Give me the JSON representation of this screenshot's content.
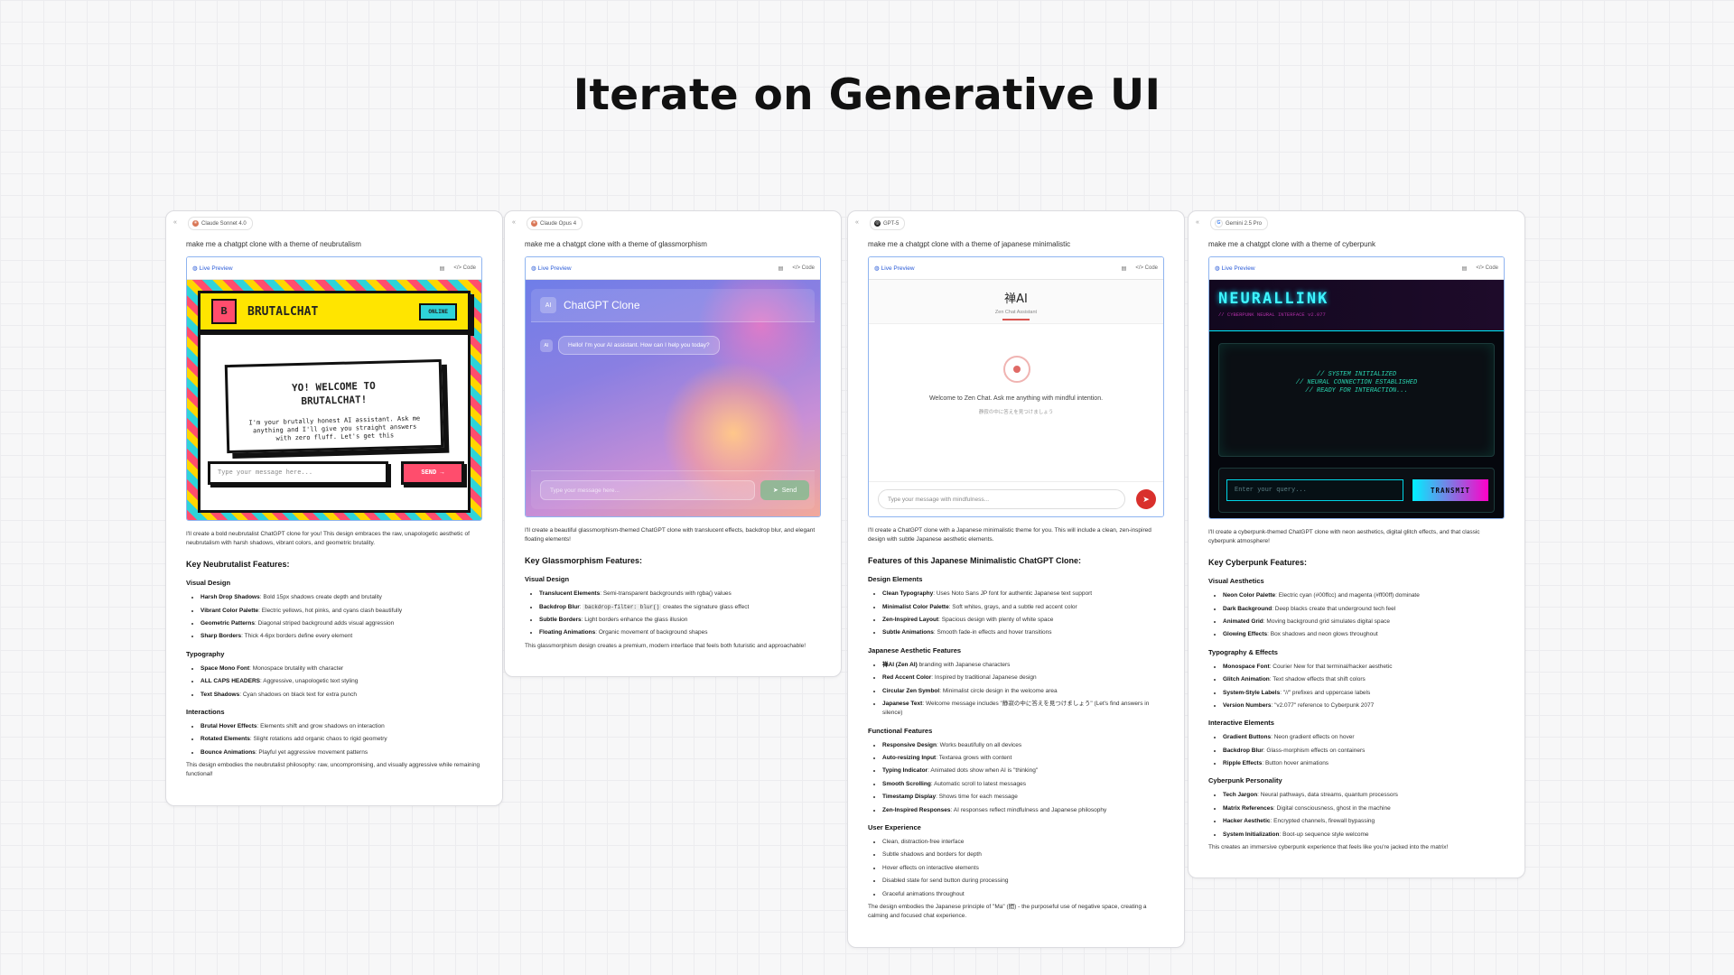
{
  "title": "Iterate on Generative UI",
  "common": {
    "collapse_icon": "«",
    "live_preview": "Live Preview",
    "code": "</> Code"
  },
  "cards": {
    "neu": {
      "model": "Claude Sonnet 4.0",
      "prompt": "make me a chatgpt clone with a theme of neubrutalism",
      "preview": {
        "logo": "B",
        "app_title": "BRUTALCHAT",
        "status": "ONLINE",
        "welcome_heading": "YO! WELCOME TO BRUTALCHAT!",
        "welcome_text": "I'm your brutally honest AI assistant. Ask me anything and I'll give you straight answers with zero fluff. Let's get this",
        "input_placeholder": "Type your message here...",
        "send_label": "SEND →"
      },
      "intro": "I'll create a bold neubrutalist ChatGPT clone for you! This design embraces the raw, unapologetic aesthetic of neubrutalism with harsh shadows, vibrant colors, and geometric brutality.",
      "heading": "Key Neubrutalist Features:",
      "sections": [
        {
          "title": "Visual Design",
          "items": [
            {
              "bold": "Harsh Drop Shadows",
              "text": ": Bold 15px shadows create depth and brutality"
            },
            {
              "bold": "Vibrant Color Palette",
              "text": ": Electric yellows, hot pinks, and cyans clash beautifully"
            },
            {
              "bold": "Geometric Patterns",
              "text": ": Diagonal striped background adds visual aggression"
            },
            {
              "bold": "Sharp Borders",
              "text": ": Thick 4-6px borders define every element"
            }
          ]
        },
        {
          "title": "Typography",
          "items": [
            {
              "bold": "Space Mono Font",
              "text": ": Monospace brutality with character"
            },
            {
              "bold": "ALL CAPS HEADERS",
              "text": ": Aggressive, unapologetic text styling"
            },
            {
              "bold": "Text Shadows",
              "text": ": Cyan shadows on black text for extra punch"
            }
          ]
        },
        {
          "title": "Interactions",
          "items": [
            {
              "bold": "Brutal Hover Effects",
              "text": ": Elements shift and grow shadows on interaction"
            },
            {
              "bold": "Rotated Elements",
              "text": ": Slight rotations add organic chaos to rigid geometry"
            },
            {
              "bold": "Bounce Animations",
              "text": ": Playful yet aggressive movement patterns"
            }
          ]
        }
      ],
      "outro": "This design embodies the neubrutalist philosophy: raw, uncompromising, and visually aggressive while remaining functional!"
    },
    "glass": {
      "model": "Claude Opus 4",
      "prompt": "make me a chatgpt clone with a theme of glassmorphism",
      "preview": {
        "avatar": "AI",
        "app_title": "ChatGPT Clone",
        "ai_badge": "AI",
        "bubble": "Hello! I'm your AI assistant. How can I help you today?",
        "input_placeholder": "Type your message here...",
        "send_label": "Send"
      },
      "intro": "I'll create a beautiful glassmorphism-themed ChatGPT clone with translucent effects, backdrop blur, and elegant floating elements!",
      "heading": "Key Glassmorphism Features:",
      "section_title": "Visual Design",
      "items": [
        {
          "bold": "Translucent Elements",
          "text": ": Semi-transparent backgrounds with rgba() values"
        },
        {
          "bold": "Backdrop Blur",
          "text": ": ",
          "code": "backdrop-filter: blur()",
          "text2": " creates the signature glass effect"
        },
        {
          "bold": "Subtle Borders",
          "text": ": Light borders enhance the glass illusion"
        },
        {
          "bold": "Floating Animations",
          "text": ": Organic movement of background shapes"
        }
      ],
      "outro": "This glassmorphism design creates a premium, modern interface that feels both futuristic and approachable!"
    },
    "jp": {
      "model": "GPT-5",
      "prompt": "make me a chatgpt clone with a theme of japanese minimalistic",
      "preview": {
        "app_title": "禅AI",
        "subtitle": "Zen Chat Assistant",
        "welcome": "Welcome to Zen Chat. Ask me anything with mindful intention.",
        "welcome_jp": "静寂の中に答えを見つけましょう",
        "input_placeholder": "Type your message with mindfulness...",
        "send_icon": "➤"
      },
      "intro": "I'll create a ChatGPT clone with a Japanese minimalistic theme for you. This will include a clean, zen-inspired design with subtle Japanese aesthetic elements.",
      "heading": "Features of this Japanese Minimalistic ChatGPT Clone:",
      "sections": [
        {
          "title": "Design Elements",
          "items": [
            {
              "bold": "Clean Typography",
              "text": ": Uses Noto Sans JP font for authentic Japanese text support"
            },
            {
              "bold": "Minimalist Color Palette",
              "text": ": Soft whites, grays, and a subtle red accent color"
            },
            {
              "bold": "Zen-Inspired Layout",
              "text": ": Spacious design with plenty of white space"
            },
            {
              "bold": "Subtle Animations",
              "text": ": Smooth fade-in effects and hover transitions"
            }
          ]
        },
        {
          "title": "Japanese Aesthetic Features",
          "items": [
            {
              "bold": "禅AI (Zen AI)",
              "text": " branding with Japanese characters"
            },
            {
              "bold": "Red Accent Color",
              "text": ": Inspired by traditional Japanese design"
            },
            {
              "bold": "Circular Zen Symbol",
              "text": ": Minimalist circle design in the welcome area"
            },
            {
              "bold": "Japanese Text",
              "text": ": Welcome message includes \"静寂の中に答えを見つけましょう\" (Let's find answers in silence)"
            }
          ]
        },
        {
          "title": "Functional Features",
          "items": [
            {
              "bold": "Responsive Design",
              "text": ": Works beautifully on all devices"
            },
            {
              "bold": "Auto-resizing Input",
              "text": ": Textarea grows with content"
            },
            {
              "bold": "Typing Indicator",
              "text": ": Animated dots show when AI is \"thinking\""
            },
            {
              "bold": "Smooth Scrolling",
              "text": ": Automatic scroll to latest messages"
            },
            {
              "bold": "Timestamp Display",
              "text": ": Shows time for each message"
            },
            {
              "bold": "Zen-Inspired Responses",
              "text": ": AI responses reflect mindfulness and Japanese philosophy"
            }
          ]
        },
        {
          "title": "User Experience",
          "items": [
            {
              "bold": "",
              "text": "Clean, distraction-free interface"
            },
            {
              "bold": "",
              "text": "Subtle shadows and borders for depth"
            },
            {
              "bold": "",
              "text": "Hover effects on interactive elements"
            },
            {
              "bold": "",
              "text": "Disabled state for send button during processing"
            },
            {
              "bold": "",
              "text": "Graceful animations throughout"
            }
          ]
        }
      ],
      "outro": "The design embodies the Japanese principle of \"Ma\" (間) - the purposeful use of negative space, creating a calming and focused chat experience."
    },
    "cyber": {
      "model": "Gemini 2.5 Pro",
      "prompt": "make me a chatgpt clone with a theme of cyberpunk",
      "preview": {
        "app_title": "NEURALLINK",
        "subtitle": "// CYBERPUNK NEURAL INTERFACE v2.077",
        "lines": [
          "// SYSTEM INITIALIZED",
          "// NEURAL CONNECTION ESTABLISHED",
          "// READY FOR INTERACTION..."
        ],
        "input_placeholder": "Enter your query...",
        "send_label": "TRANSMIT"
      },
      "intro": "I'll create a cyberpunk-themed ChatGPT clone with neon aesthetics, digital glitch effects, and that classic cyberpunk atmosphere!",
      "heading": "Key Cyberpunk Features:",
      "sections": [
        {
          "title": "Visual Aesthetics",
          "items": [
            {
              "bold": "Neon Color Palette",
              "text": ": Electric cyan (#00ffcc) and magenta (#ff00ff) dominate"
            },
            {
              "bold": "Dark Background",
              "text": ": Deep blacks create that underground tech feel"
            },
            {
              "bold": "Animated Grid",
              "text": ": Moving background grid simulates digital space"
            },
            {
              "bold": "Glowing Effects",
              "text": ": Box shadows and neon glows throughout"
            }
          ]
        },
        {
          "title": "Typography & Effects",
          "items": [
            {
              "bold": "Monospace Font",
              "text": ": Courier New for that terminal/hacker aesthetic"
            },
            {
              "bold": "Glitch Animation",
              "text": ": Text shadow effects that shift colors"
            },
            {
              "bold": "System-Style Labels",
              "text": ": \"//\" prefixes and uppercase labels"
            },
            {
              "bold": "Version Numbers",
              "text": ": \"v2.077\" reference to Cyberpunk 2077"
            }
          ]
        },
        {
          "title": "Interactive Elements",
          "items": [
            {
              "bold": "Gradient Buttons",
              "text": ": Neon gradient effects on hover"
            },
            {
              "bold": "Backdrop Blur",
              "text": ": Glass-morphism effects on containers"
            },
            {
              "bold": "Ripple Effects",
              "text": ": Button hover animations"
            }
          ]
        },
        {
          "title": "Cyberpunk Personality",
          "items": [
            {
              "bold": "Tech Jargon",
              "text": ": Neural pathways, data streams, quantum processors"
            },
            {
              "bold": "Matrix References",
              "text": ": Digital consciousness, ghost in the machine"
            },
            {
              "bold": "Hacker Aesthetic",
              "text": ": Encrypted channels, firewall bypassing"
            },
            {
              "bold": "System Initialization",
              "text": ": Boot-up sequence style welcome"
            }
          ]
        }
      ],
      "outro": "This creates an immersive cyberpunk experience that feels like you're jacked into the matrix!"
    }
  }
}
